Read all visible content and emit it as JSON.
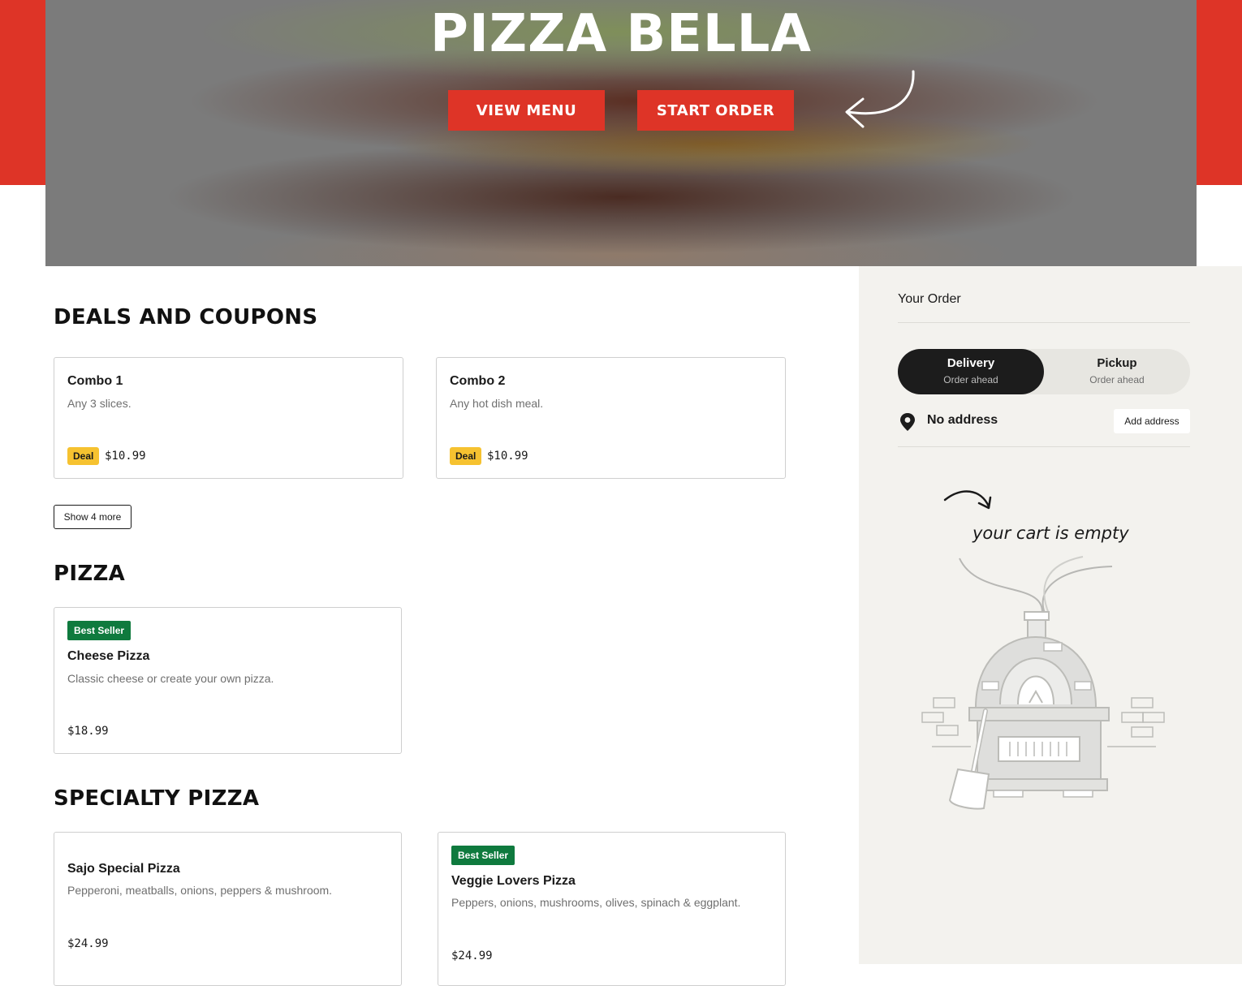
{
  "hero": {
    "title": "PIZZA BELLA",
    "view_menu_label": "VIEW MENU",
    "start_order_label": "START ORDER"
  },
  "sections": {
    "deals": {
      "title": "DEALS AND COUPONS",
      "items": [
        {
          "name": "Combo 1",
          "description": "Any 3 slices.",
          "badge": "Deal",
          "price": "$10.99"
        },
        {
          "name": "Combo 2",
          "description": "Any hot dish meal.",
          "badge": "Deal",
          "price": "$10.99"
        }
      ],
      "show_more_label": "Show 4 more"
    },
    "pizza": {
      "title": "PIZZA",
      "items": [
        {
          "badge": "Best Seller",
          "name": "Cheese Pizza",
          "description": "Classic cheese or create your own pizza.",
          "price": "$18.99"
        }
      ]
    },
    "specialty": {
      "title": "SPECIALTY PIZZA",
      "items": [
        {
          "name": "Sajo Special Pizza",
          "description": "Pepperoni, meatballs, onions, peppers & mushroom.",
          "price": "$24.99"
        },
        {
          "badge": "Best Seller",
          "name": "Veggie Lovers Pizza",
          "description": "Peppers, onions, mushrooms, olives, spinach & eggplant.",
          "price": "$24.99"
        }
      ]
    }
  },
  "order": {
    "title": "Your Order",
    "modes": [
      {
        "label": "Delivery",
        "sublabel": "Order ahead",
        "selected": true
      },
      {
        "label": "Pickup",
        "sublabel": "Order ahead",
        "selected": false
      }
    ],
    "address_text": "No address",
    "add_address_label": "Add address",
    "empty_cart_text": "your cart is empty"
  },
  "colors": {
    "brand_red": "#de3427",
    "deal_yellow": "#f6c230",
    "best_seller_green": "#0f7a3e",
    "sidebar_bg": "#f3f2ee"
  }
}
